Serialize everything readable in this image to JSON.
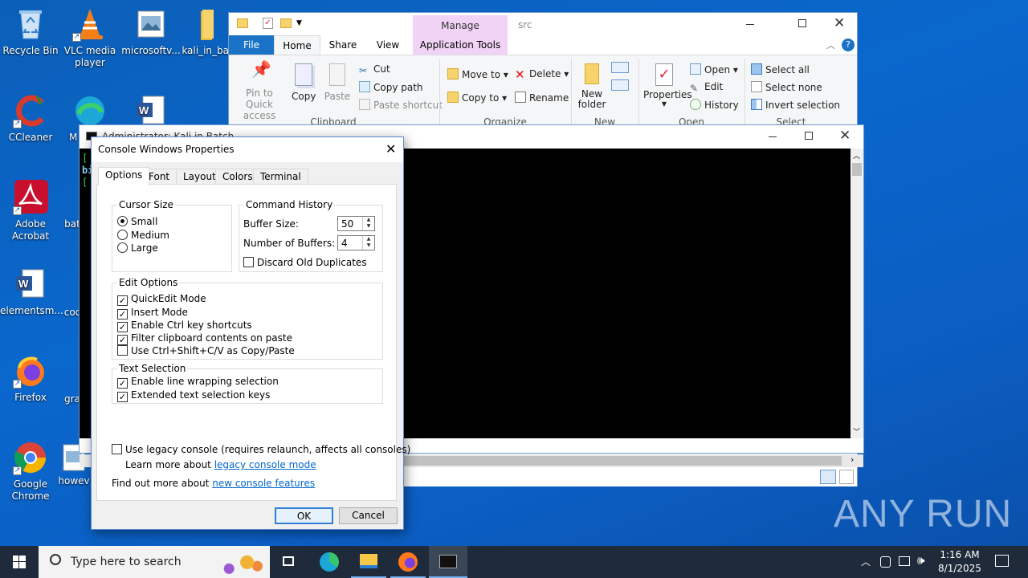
{
  "desktop": {
    "icons": [
      {
        "label": "Recycle Bin"
      },
      {
        "label": "VLC media player"
      },
      {
        "label": "microsoftv..."
      },
      {
        "label": "kali_in_bat"
      },
      {
        "label": "CCleaner"
      },
      {
        "label": "M"
      },
      {
        "label": "Adobe Acrobat"
      },
      {
        "label": "bat"
      },
      {
        "label": "elementsm..."
      },
      {
        "label": "coc"
      },
      {
        "label": "Firefox"
      },
      {
        "label": "gra"
      },
      {
        "label": "Google Chrome"
      },
      {
        "label": "howev"
      }
    ]
  },
  "explorer": {
    "title": "src",
    "context_tab": "Manage",
    "tabs": [
      "File",
      "Home",
      "Share",
      "View",
      "Application Tools"
    ],
    "clipboard": {
      "pin": "Pin to Quick access",
      "copy": "Copy",
      "paste": "Paste",
      "cut": "Cut",
      "copy_path": "Copy path",
      "paste_shortcut": "Paste shortcut",
      "group": "Clipboard"
    },
    "organize": {
      "move_to": "Move to",
      "copy_to": "Copy to",
      "delete": "Delete",
      "rename": "Rename",
      "group": "Organize"
    },
    "new": {
      "new_folder": "New folder",
      "group": "New"
    },
    "open": {
      "properties": "Properties",
      "open": "Open",
      "edit": "Edit",
      "history": "History",
      "group": "Open"
    },
    "select": {
      "select_all": "Select all",
      "select_none": "Select none",
      "invert": "Invert selection",
      "group": "Select"
    }
  },
  "console": {
    "title": "Administrator:  Kali in Batch",
    "lines": [
      "[",
      "bi",
      "["
    ]
  },
  "dialog": {
    "title": "Console Windows Properties",
    "tabs": [
      "Options",
      "Font",
      "Layout",
      "Colors",
      "Terminal"
    ],
    "cursor_size": {
      "legend": "Cursor Size",
      "options": [
        "Small",
        "Medium",
        "Large"
      ],
      "selected": "Small"
    },
    "command_history": {
      "legend": "Command History",
      "buffer_size_label": "Buffer Size:",
      "buffer_size": "50",
      "num_buffers_label": "Number of Buffers:",
      "num_buffers": "4",
      "discard_label": "Discard Old Duplicates"
    },
    "edit_options": {
      "legend": "Edit Options",
      "items": [
        {
          "label": "QuickEdit Mode",
          "checked": true
        },
        {
          "label": "Insert Mode",
          "checked": true
        },
        {
          "label": "Enable Ctrl key shortcuts",
          "checked": true
        },
        {
          "label": "Filter clipboard contents on paste",
          "checked": true
        },
        {
          "label": "Use Ctrl+Shift+C/V as Copy/Paste",
          "checked": false
        }
      ]
    },
    "text_selection": {
      "legend": "Text Selection",
      "items": [
        {
          "label": "Enable line wrapping selection",
          "checked": true
        },
        {
          "label": "Extended text selection keys",
          "checked": true
        }
      ]
    },
    "legacy_label": "Use legacy console (requires relaunch, affects all consoles)",
    "learn_more": "Learn more about",
    "learn_more_link": "legacy console mode",
    "find_out": "Find out more about",
    "find_out_link": "new console features",
    "ok": "OK",
    "cancel": "Cancel"
  },
  "taskbar": {
    "search_placeholder": "Type here to search",
    "time": "1:16 AM",
    "date": "8/1/2025"
  },
  "watermark": "ANY RUN"
}
